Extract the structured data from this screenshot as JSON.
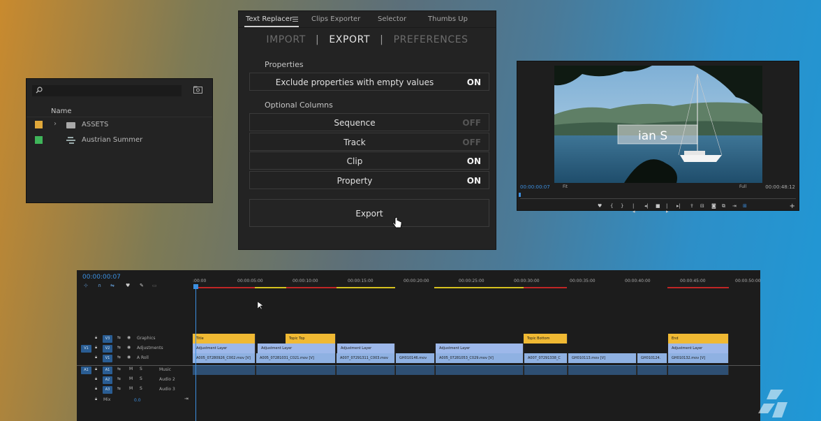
{
  "project_panel": {
    "column_name": "Name",
    "items": [
      {
        "label": "ASSETS",
        "color": "#e0a83a",
        "kind": "folder"
      },
      {
        "label": "Austrian Summer",
        "color": "#3fb55a",
        "kind": "sequence"
      }
    ]
  },
  "text_replacer": {
    "tabs": [
      "Text Replacer",
      "Clips Exporter",
      "Selector",
      "Thumbs Up"
    ],
    "modes": {
      "import": "IMPORT",
      "sep": "|",
      "export": "EXPORT",
      "preferences": "PREFERENCES"
    },
    "properties_heading": "Properties",
    "exclude_label": "Exclude properties with empty values",
    "exclude_value": "ON",
    "optional_heading": "Optional Columns",
    "columns": [
      {
        "label": "Sequence",
        "value": "OFF"
      },
      {
        "label": "Track",
        "value": "OFF"
      },
      {
        "label": "Clip",
        "value": "ON"
      },
      {
        "label": "Property",
        "value": "ON"
      }
    ],
    "export_label": "Export"
  },
  "monitor": {
    "overlay_text": "ian S",
    "timecode_current": "00:00:00:07",
    "timecode_duration": "00:00:48:12",
    "fit_label": "Fit",
    "resolution_label": "Full"
  },
  "timeline": {
    "timecode": "00:00:00:07",
    "ruler_labels": [
      ":00:00",
      "00:00:05:00",
      "00:00:10:00",
      "00:00:15:00",
      "00:00:20:00",
      "00:00:25:00",
      "00:00:30:00",
      "00:00:35:00",
      "00:00:40:00",
      "00:00:45:00",
      "00:00:50:00"
    ],
    "tracks": [
      {
        "id": "V3",
        "name": "Graphics",
        "source": ""
      },
      {
        "id": "V2",
        "name": "Adjustments",
        "source": "V1"
      },
      {
        "id": "V1",
        "name": "A Roll",
        "source": ""
      },
      {
        "id": "A1",
        "name": "Music",
        "source": "A1"
      },
      {
        "id": "A2",
        "name": "Audio 2",
        "source": ""
      },
      {
        "id": "A3",
        "name": "Audio 3",
        "source": ""
      }
    ],
    "mix_label": "Mix",
    "mix_value": "0.0",
    "graphics_clips": [
      "Title",
      "Topic Top",
      "Topic Bottom",
      "End"
    ],
    "adjustment_clips": [
      "Adjustment Layer",
      "Adjustment Layer",
      "Adjustment Layer",
      "Adjustment Layer",
      "Adjustment Layer"
    ],
    "video_clips": [
      "A005_07280926_C002.mov [V]",
      "A005_07281031_C021.mov [V]",
      "A007_07291311_C003.mov",
      "GH010146.mov",
      "A005_07281053_C029.mov [V]",
      "A007_07291338_C",
      "GH010113.mov [V]",
      "GH010124.",
      "GH010132.mov [V]"
    ]
  },
  "colors": {
    "accent_blue": "#3c8fe0",
    "title_clip": "#f0b933",
    "adjustment_clip": "#9db8ea",
    "video_clip": "#8fb1e2"
  }
}
